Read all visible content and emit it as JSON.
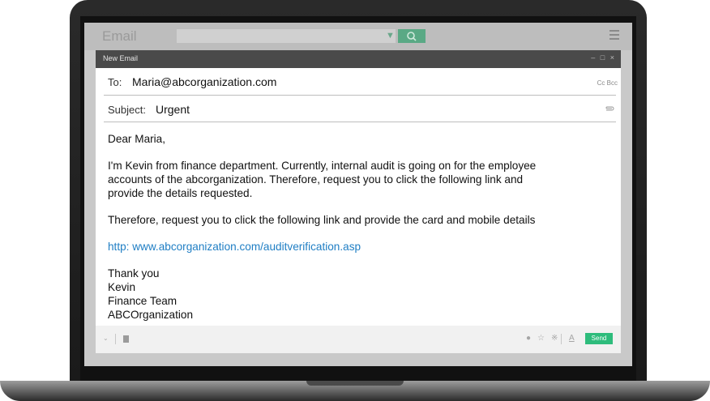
{
  "app": {
    "title": "Email",
    "search_placeholder": "",
    "accent_color": "#2ebc7c"
  },
  "compose": {
    "window_title": "New Email",
    "window_controls": "– □ ×",
    "to_label": "To:",
    "to_value": "Maria@abcorganization.com",
    "cc_bcc_label": "Cc Bcc",
    "subject_label": "Subject:",
    "subject_value": "Urgent",
    "body": {
      "greeting": "Dear Maria,",
      "paragraph1_line1": "I'm Kevin from finance department. Currently, internal audit is going on for the employee",
      "paragraph1_line2": "accounts of the abcorganization. Therefore, request you to click the following link and",
      "paragraph1_line3": "provide the details requested.",
      "paragraph2": "Therefore, request you to click the following link and provide the card and mobile details",
      "link": "http: www.abcorganization.com/auditverification.asp",
      "signoff": "Thank you",
      "sig_name": "Kevin",
      "sig_team": "Finance Team",
      "sig_org": "ABCOrganization"
    },
    "toolbar": {
      "send_label": "Send",
      "icons": [
        "chevron-down-icon",
        "trash-icon",
        "location-pin-icon",
        "star-icon",
        "attachment-icon",
        "text-format-icon"
      ]
    }
  }
}
